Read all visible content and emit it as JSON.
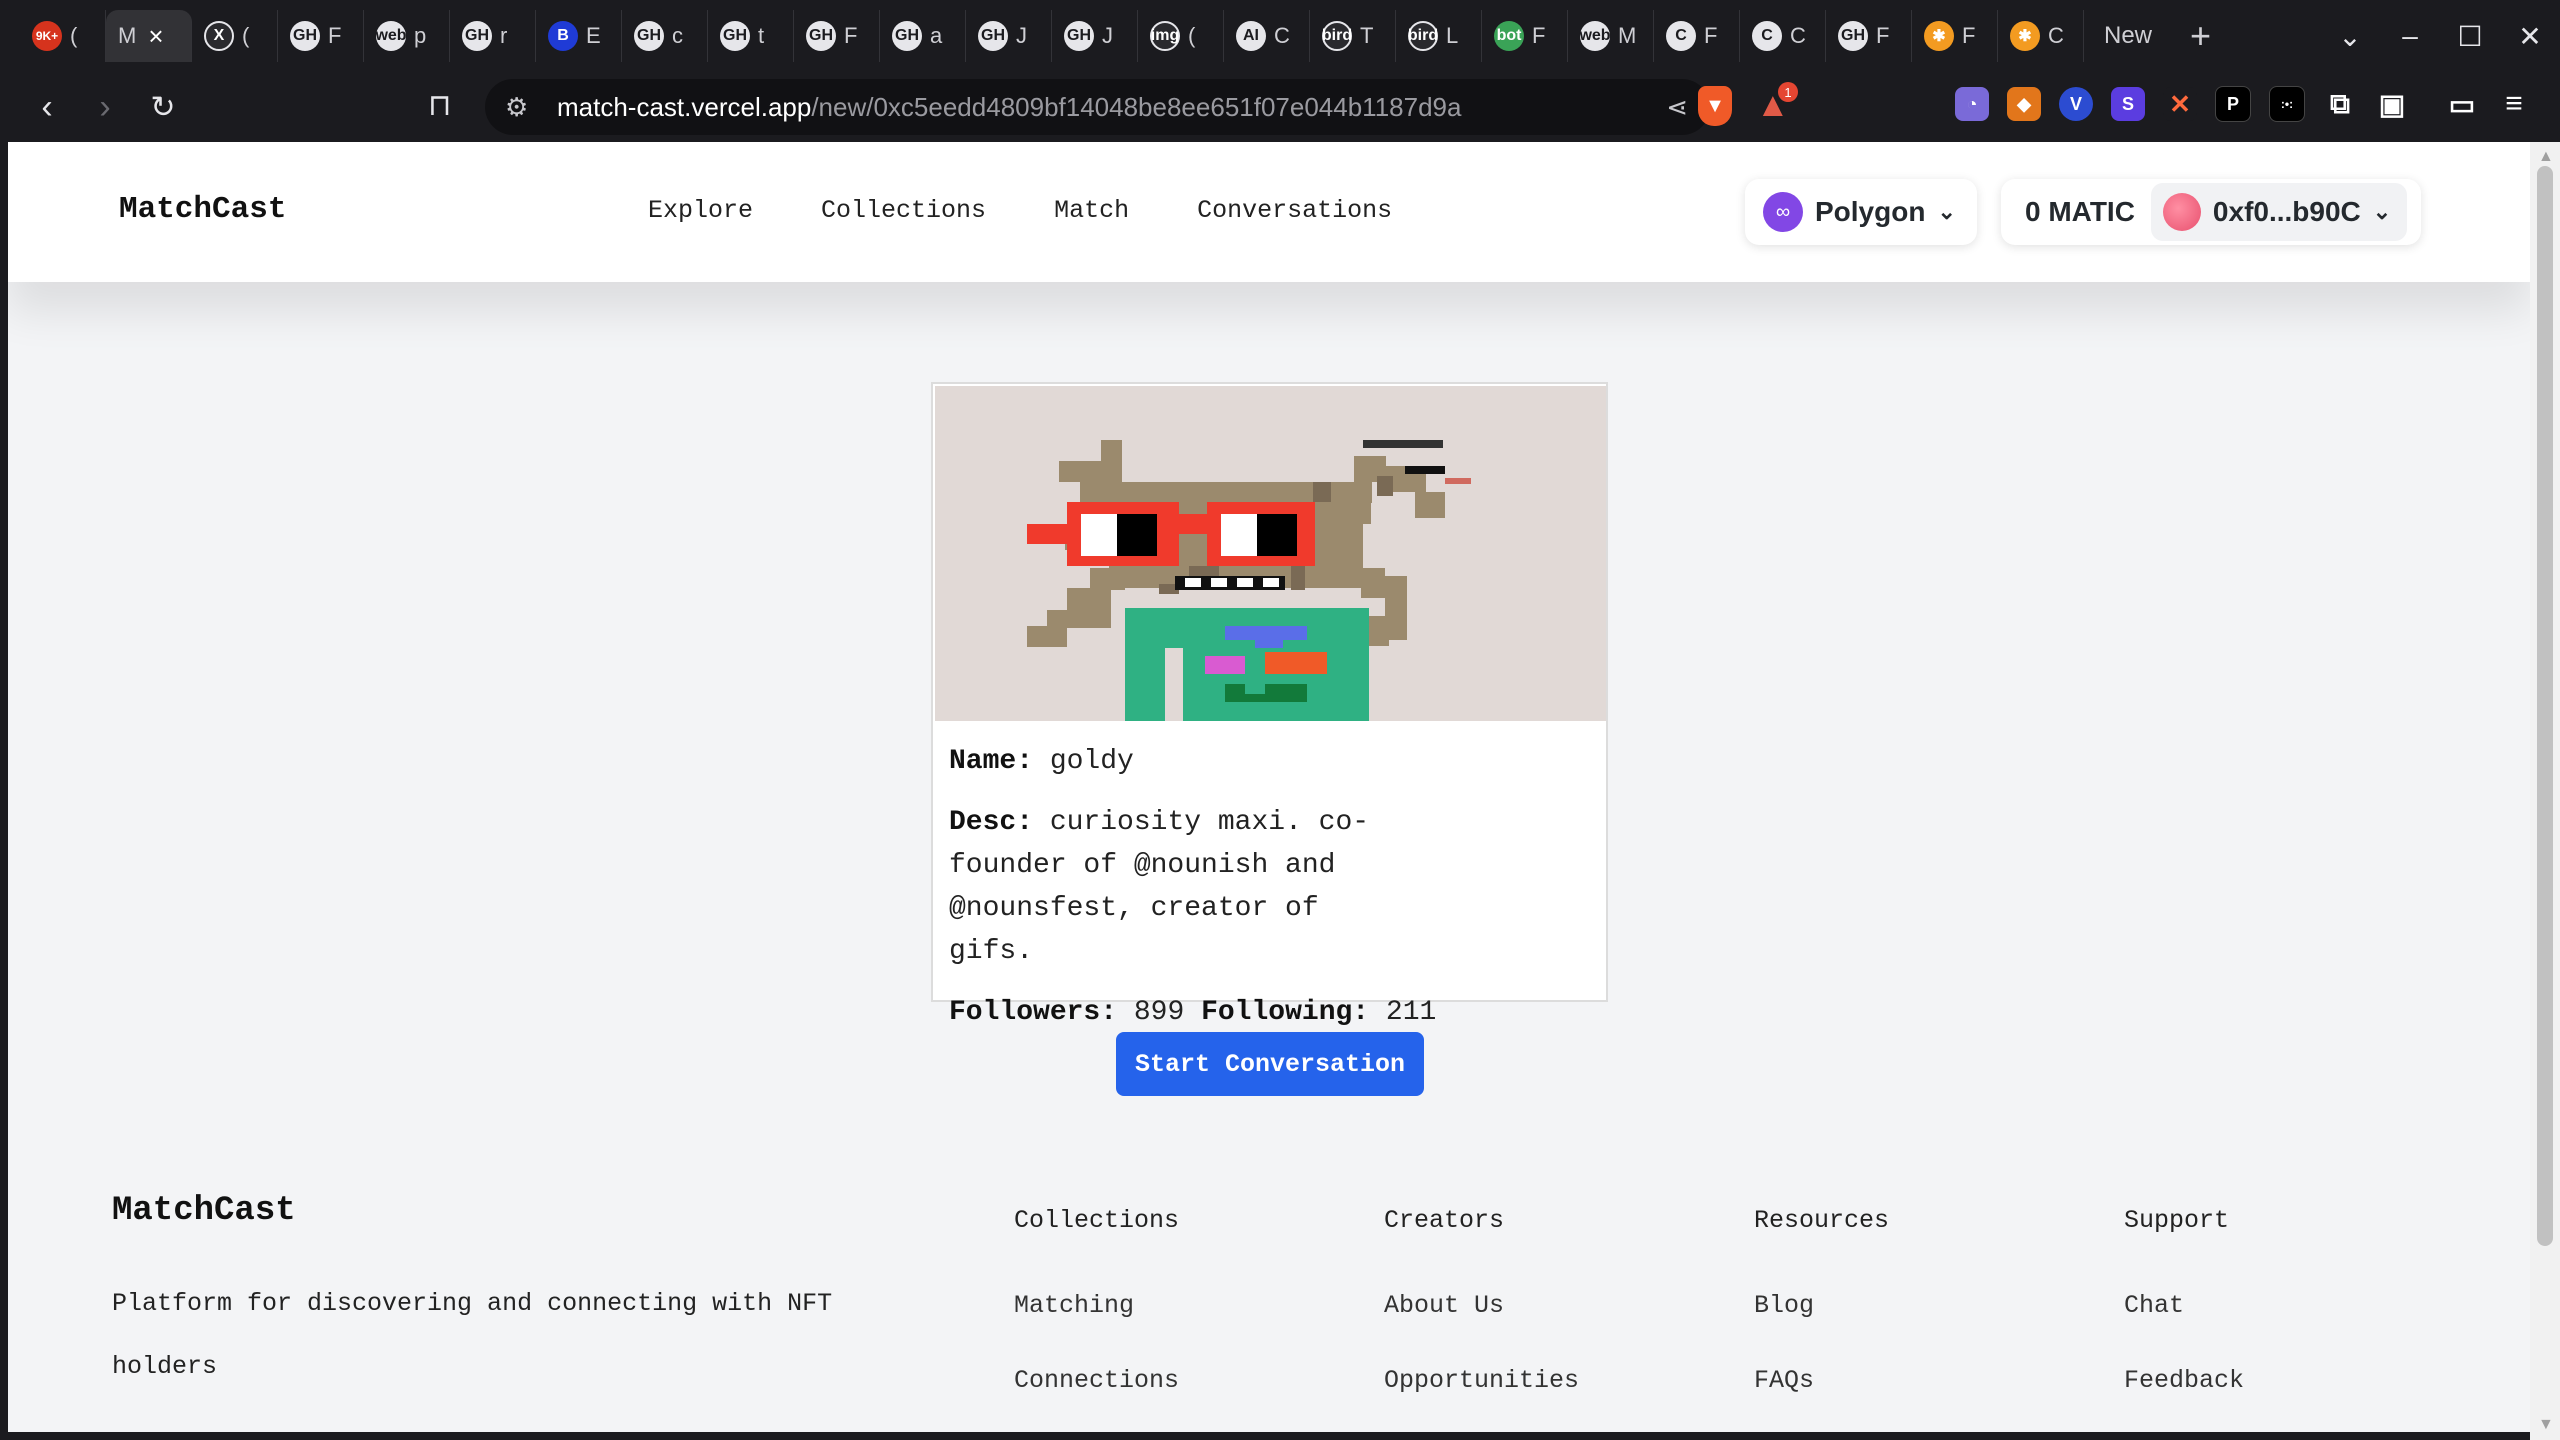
{
  "browser": {
    "tabs": [
      {
        "favicon": "9K+",
        "title": "(",
        "variant": "red"
      },
      {
        "favicon": "",
        "title": "M",
        "active": true
      },
      {
        "favicon": "X",
        "title": "(",
        "variant": "dark"
      },
      {
        "favicon": "GH",
        "title": "F",
        "variant": "gh"
      },
      {
        "favicon": "web",
        "title": "p",
        "variant": "globe"
      },
      {
        "favicon": "GH",
        "title": "r",
        "variant": "gh"
      },
      {
        "favicon": "B",
        "title": "E",
        "variant": "blue"
      },
      {
        "favicon": "GH",
        "title": "c",
        "variant": "gh"
      },
      {
        "favicon": "GH",
        "title": "t",
        "variant": "gh"
      },
      {
        "favicon": "GH",
        "title": "F",
        "variant": "gh"
      },
      {
        "favicon": "GH",
        "title": "a",
        "variant": "gh"
      },
      {
        "favicon": "GH",
        "title": "J",
        "variant": "gh"
      },
      {
        "favicon": "GH",
        "title": "J",
        "variant": "gh"
      },
      {
        "favicon": "img",
        "title": "(",
        "variant": "dark"
      },
      {
        "favicon": "AI",
        "title": "C",
        "variant": "gh"
      },
      {
        "favicon": "bird",
        "title": "T",
        "variant": "dark"
      },
      {
        "favicon": "bird",
        "title": "L",
        "variant": "dark"
      },
      {
        "favicon": "bot",
        "title": "F",
        "variant": "green"
      },
      {
        "favicon": "web",
        "title": "M",
        "variant": "globe"
      },
      {
        "favicon": "C",
        "title": "F",
        "variant": "gh"
      },
      {
        "favicon": "C",
        "title": "C",
        "variant": "gh"
      },
      {
        "favicon": "GH",
        "title": "F",
        "variant": "gh"
      },
      {
        "favicon": "✱",
        "title": "F",
        "variant": "orange"
      },
      {
        "favicon": "✱",
        "title": "C",
        "variant": "orange"
      }
    ],
    "new_tab_label": "New",
    "url_domain": "match-cast.vercel.app",
    "url_path": "/new/0xc5eedd4809bf14048be8ee651f07e044b1187d9a",
    "rewards_badge": "1"
  },
  "header": {
    "brand": "MatchCast",
    "nav": [
      "Explore",
      "Collections",
      "Match",
      "Conversations"
    ],
    "chain": "Polygon",
    "balance": "0 MATIC",
    "address": "0xf0...b90C"
  },
  "profile": {
    "name_label": "Name:",
    "name": "goldy",
    "desc_label": "Desc:",
    "desc": "curiosity maxi. co-founder of @nounish and @nounsfest, creator of gifs.",
    "followers_label": "Followers:",
    "followers": "899",
    "following_label": "Following:",
    "following": "211",
    "cta": "Start Conversation"
  },
  "footer": {
    "brand": "MatchCast",
    "tagline": "Platform for discovering and connecting with NFT holders",
    "columns": [
      {
        "heading": "Collections",
        "links": [
          "Matching",
          "Connections"
        ]
      },
      {
        "heading": "Creators",
        "links": [
          "About Us",
          "Opportunities"
        ]
      },
      {
        "heading": "Resources",
        "links": [
          "Blog",
          "FAQs"
        ]
      },
      {
        "heading": "Support",
        "links": [
          "Chat",
          "Feedback"
        ]
      }
    ]
  },
  "colors": {
    "primary": "#2563eb",
    "polygon": "#8247e5",
    "nft_background": "#e1d9d6",
    "nft_body": "#9b8a6d",
    "nft_glasses": "#f03a2c",
    "nft_shirt": "#2fb183"
  }
}
